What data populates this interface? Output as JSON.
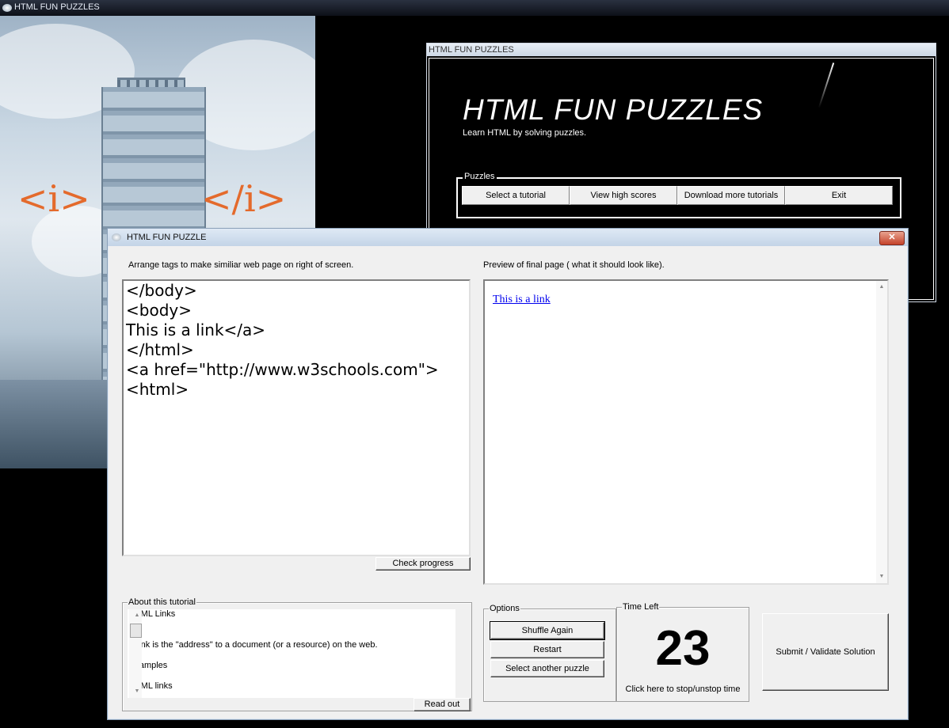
{
  "outer_window": {
    "title": "HTML FUN PUZZLES"
  },
  "background": {
    "tag_open": "<i>",
    "tag_close": "</i>"
  },
  "main_window": {
    "title": "HTML FUN PUZZLES",
    "heading": "HTML FUN PUZZLES",
    "subtitle": "Learn HTML by solving puzzles.",
    "group_label": "Puzzles",
    "buttons": [
      "Select a tutorial",
      "View high scores",
      "Download more tutorials",
      "Exit"
    ]
  },
  "dialog": {
    "title": "HTML FUN PUZZLE",
    "close_label": "✕",
    "left_instruction": "Arrange tags to make similiar web page on right of screen.",
    "right_instruction": "Preview of final page ( what it should look like).",
    "tag_lines": [
      "</body>",
      "<body>",
      "This is a link</a>",
      "</html>",
      "<a href=\"http://www.w3schools.com\">",
      "<html>"
    ],
    "check_progress": "Check progress",
    "preview_link": "This is a link",
    "about": {
      "label": "About this tutorial",
      "lines": [
        "HTML Links",
        "A link is the \"address\" to a document (or a resource) on the web.",
        "Examples",
        "HTML links"
      ],
      "read_out": "Read out"
    },
    "options": {
      "label": "Options",
      "shuffle": "Shuffle Again",
      "restart": "Restart",
      "select_another": "Select another puzzle"
    },
    "time": {
      "label": "Time Left",
      "value": "23",
      "hint": "Click here to stop/unstop time"
    },
    "submit": "Submit / Validate Solution"
  },
  "icons": [
    "app-icon",
    "close-icon",
    "scroll-up-icon",
    "scroll-down-icon"
  ]
}
